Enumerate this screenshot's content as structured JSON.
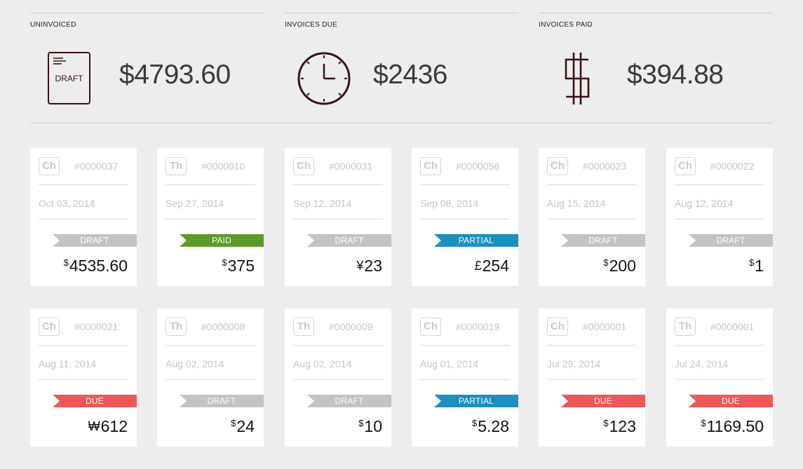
{
  "summary": [
    {
      "title": "UNINVOICED",
      "icon": "draft-document-icon",
      "icon_text": "DRAFT",
      "amount": "$4793.60"
    },
    {
      "title": "INVOICES DUE",
      "icon": "clock-icon",
      "amount": "$2436"
    },
    {
      "title": "INVOICES PAID",
      "icon": "dollar-sign-icon",
      "amount": "$394.88"
    }
  ],
  "invoices": [
    {
      "initials": "Ch",
      "number": "#0000037",
      "date": "Oct 03, 2014",
      "status": "DRAFT",
      "currency": "$",
      "amount": "4535.60"
    },
    {
      "initials": "Th",
      "number": "#0000010",
      "date": "Sep 27, 2014",
      "status": "PAID",
      "currency": "$",
      "amount": "375"
    },
    {
      "initials": "Ch",
      "number": "#0000031",
      "date": "Sep 12, 2014",
      "status": "DRAFT",
      "currency": "¥",
      "amount": "23"
    },
    {
      "initials": "Ch",
      "number": "#0000056",
      "date": "Sep 08, 2014",
      "status": "PARTIAL",
      "currency": "£",
      "amount": "254"
    },
    {
      "initials": "Ch",
      "number": "#0000023",
      "date": "Aug 15, 2014",
      "status": "DRAFT",
      "currency": "$",
      "amount": "200"
    },
    {
      "initials": "Ch",
      "number": "#0000022",
      "date": "Aug 12, 2014",
      "status": "DRAFT",
      "currency": "$",
      "amount": "1"
    },
    {
      "initials": "Ch",
      "number": "#0000021",
      "date": "Aug 11, 2014",
      "status": "DUE",
      "currency": "₩",
      "amount": "612"
    },
    {
      "initials": "Th",
      "number": "#0000008",
      "date": "Aug 02, 2014",
      "status": "DRAFT",
      "currency": "$",
      "amount": "24"
    },
    {
      "initials": "Th",
      "number": "#0000009",
      "date": "Aug 02, 2014",
      "status": "DRAFT",
      "currency": "$",
      "amount": "10"
    },
    {
      "initials": "Ch",
      "number": "#0000019",
      "date": "Aug 01, 2014",
      "status": "PARTIAL",
      "currency": "$",
      "amount": "5.28"
    },
    {
      "initials": "Ch",
      "number": "#0000001",
      "date": "Jul 29, 2014",
      "status": "DUE",
      "currency": "$",
      "amount": "123"
    },
    {
      "initials": "Th",
      "number": "#0000001",
      "date": "Jul 24, 2014",
      "status": "DUE",
      "currency": "$",
      "amount": "1169.50"
    }
  ],
  "colors": {
    "draft": "#c3c3c3",
    "paid": "#5a9c27",
    "partial": "#1b8fbf",
    "due": "#ee5856",
    "icon": "#3a0f14"
  }
}
